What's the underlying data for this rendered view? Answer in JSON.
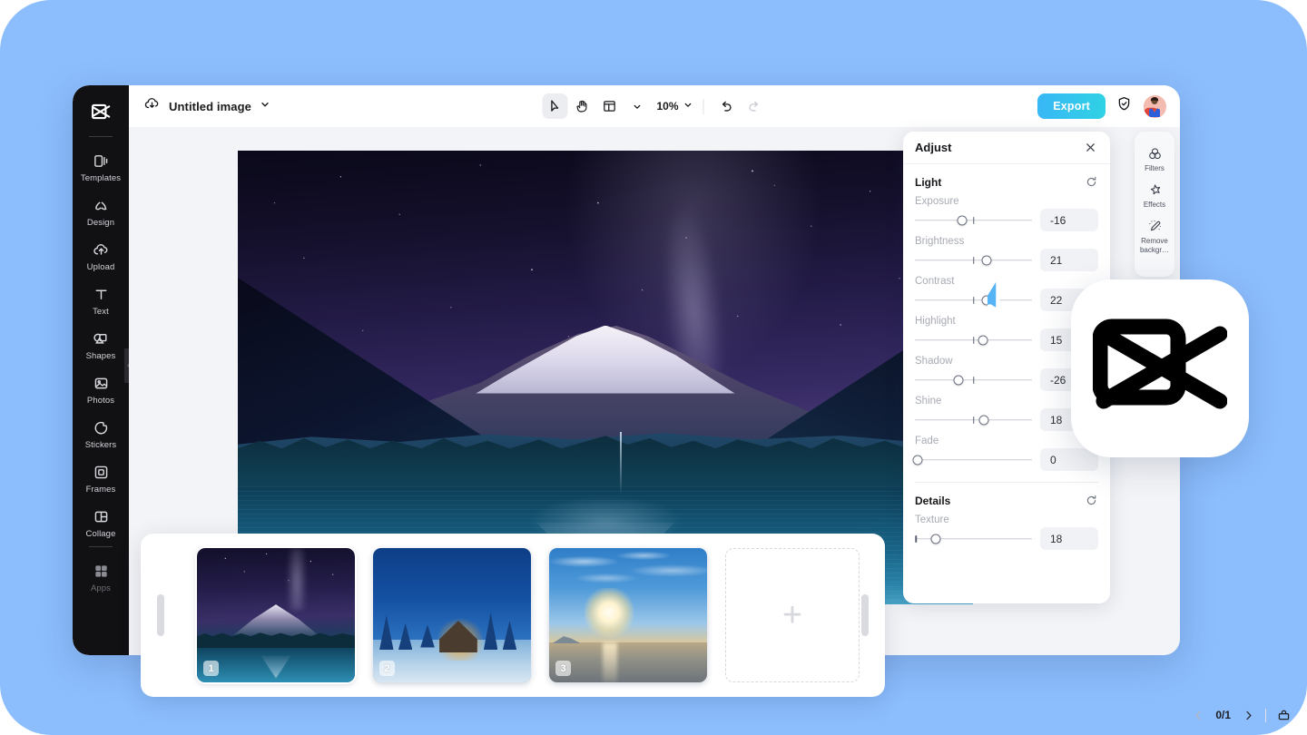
{
  "theme": {
    "backdrop_color": "#8CBDFD",
    "accent_color": "#36C5F0",
    "sidebar_color": "#111114",
    "canvas_bg": "#F3F4F7"
  },
  "sidebar": {
    "logo_name": "capcut-logo",
    "items": [
      {
        "label": "Templates",
        "icon": "templates-icon"
      },
      {
        "label": "Design",
        "icon": "design-icon"
      },
      {
        "label": "Upload",
        "icon": "upload-icon"
      },
      {
        "label": "Text",
        "icon": "text-icon"
      },
      {
        "label": "Shapes",
        "icon": "shapes-icon"
      },
      {
        "label": "Photos",
        "icon": "photos-icon"
      },
      {
        "label": "Stickers",
        "icon": "stickers-icon"
      },
      {
        "label": "Frames",
        "icon": "frames-icon"
      },
      {
        "label": "Collage",
        "icon": "collage-icon"
      },
      {
        "label": "Apps",
        "icon": "apps-icon"
      }
    ]
  },
  "topbar": {
    "cloud_icon": "cloud-sync-icon",
    "doc_title": "Untitled image",
    "title_chevron": "chevron-down-icon",
    "tools": [
      {
        "name": "select-tool",
        "icon": "cursor-arrow-icon",
        "active": true
      },
      {
        "name": "hand-tool",
        "icon": "hand-icon",
        "active": false
      },
      {
        "name": "layout-tool",
        "icon": "layout-icon",
        "active": false
      }
    ],
    "zoom_value": "10%",
    "zoom_chevron": "chevron-down-icon",
    "undo_icon": "undo-icon",
    "redo_icon": "redo-icon",
    "export_label": "Export",
    "shield_icon": "shield-check-icon",
    "avatar_name": "user-avatar"
  },
  "right_rail": {
    "items": [
      {
        "label": "Filters",
        "icon": "filters-icon"
      },
      {
        "label": "Effects",
        "icon": "effects-icon"
      },
      {
        "label": "Remove backgr…",
        "icon": "remove-background-icon"
      }
    ]
  },
  "adjust_panel": {
    "title": "Adjust",
    "close_icon": "close-icon",
    "sections": [
      {
        "title": "Light",
        "reset_icon": "reset-icon",
        "sliders": [
          {
            "label": "Exposure",
            "value": "-16",
            "pos": 40,
            "tick": 50
          },
          {
            "label": "Brightness",
            "value": "21",
            "pos": 61,
            "tick": 50
          },
          {
            "label": "Contrast",
            "value": "22",
            "pos": 61,
            "tick": 50
          },
          {
            "label": "Highlight",
            "value": "15",
            "pos": 58,
            "tick": 50
          },
          {
            "label": "Shadow",
            "value": "-26",
            "pos": 37,
            "tick": 50
          },
          {
            "label": "Shine",
            "value": "18",
            "pos": 59,
            "tick": 50
          },
          {
            "label": "Fade",
            "value": "0",
            "pos": 1,
            "tick": -10
          }
        ]
      },
      {
        "title": "Details",
        "reset_icon": "reset-icon",
        "sliders": [
          {
            "label": "Texture",
            "value": "18",
            "pos": 18,
            "tick": 1
          }
        ]
      }
    ]
  },
  "thumb_strip": {
    "left_handle": "scroll-handle-left",
    "right_handle": "scroll-handle-right",
    "thumbs": [
      {
        "badge": "1",
        "art": "t1",
        "selected": true
      },
      {
        "badge": "2",
        "art": "t2",
        "selected": false
      },
      {
        "badge": "3",
        "art": "t3",
        "selected": false
      }
    ],
    "add_label": "+"
  },
  "pager": {
    "prev_icon": "chevron-left-icon",
    "count": "0/1",
    "next_icon": "chevron-right-icon",
    "crop_icon": "crop-icon"
  },
  "cursor": {
    "name": "mouse-pointer",
    "color": "#56B3F5"
  },
  "badge": {
    "name": "capcut-app-icon"
  }
}
